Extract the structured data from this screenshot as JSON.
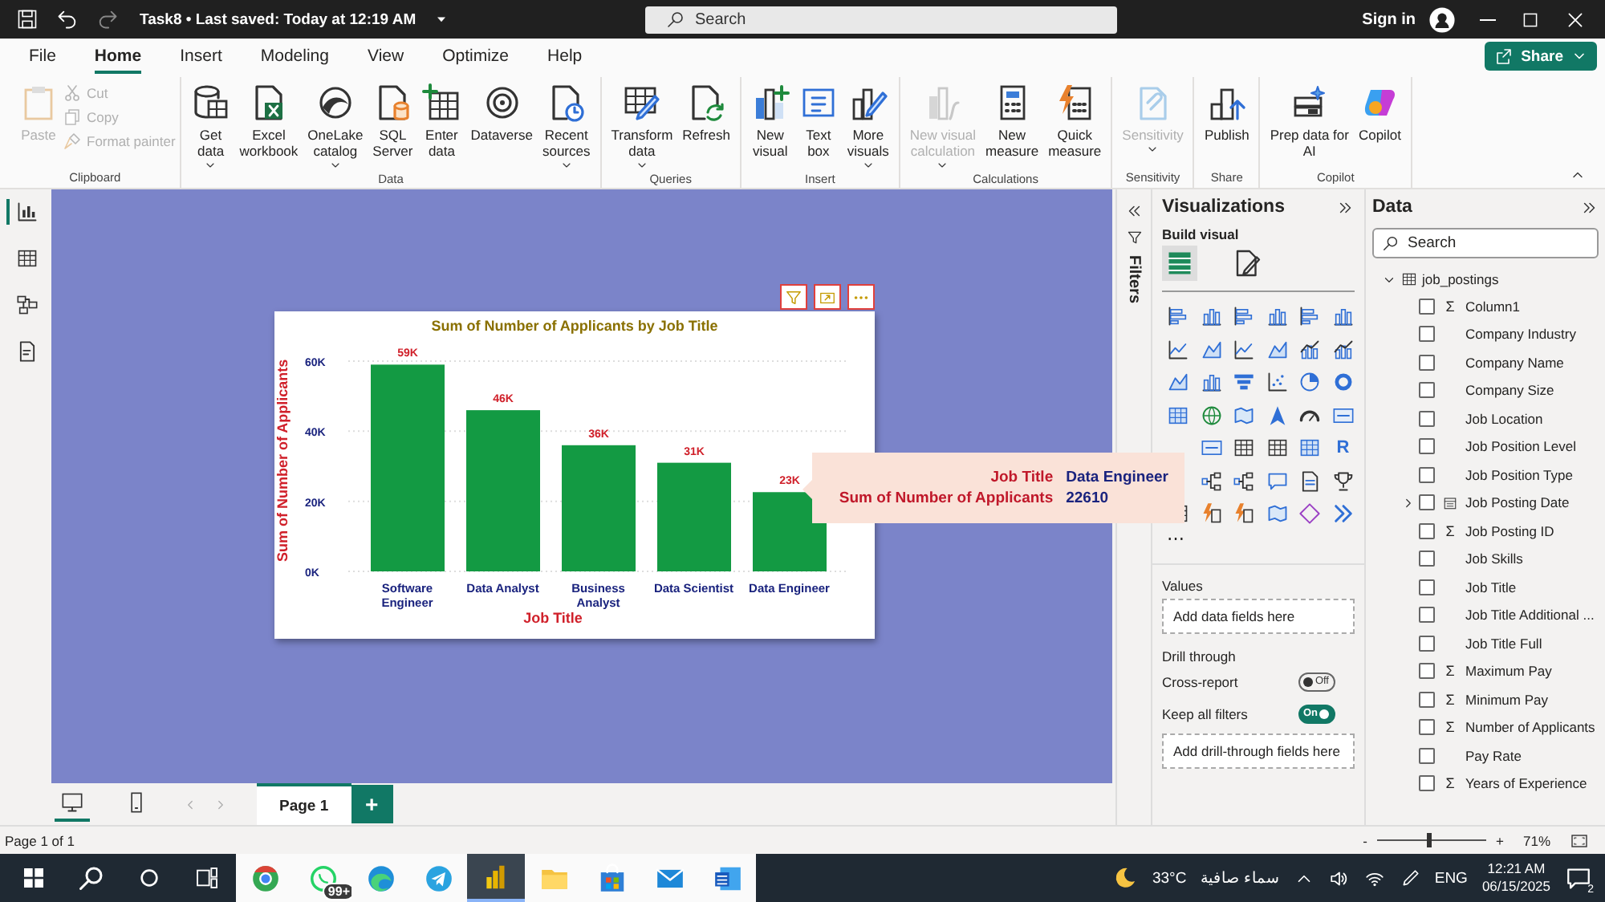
{
  "title_bar": {
    "title": "Task8 • Last saved: Today at 12:19 AM",
    "search_placeholder": "Search",
    "sign_in": "Sign in"
  },
  "ribbon": {
    "tabs": [
      {
        "label": "File",
        "selected": false
      },
      {
        "label": "Home",
        "selected": true
      },
      {
        "label": "Insert",
        "selected": false
      },
      {
        "label": "Modeling",
        "selected": false
      },
      {
        "label": "View",
        "selected": false
      },
      {
        "label": "Optimize",
        "selected": false
      },
      {
        "label": "Help",
        "selected": false
      }
    ],
    "share": "Share",
    "groups": [
      {
        "label": "Clipboard",
        "buttons": [
          {
            "lines": [
              "Paste"
            ],
            "dropdown": false,
            "disabled": true
          }
        ],
        "small_buttons": [
          {
            "label": "Cut",
            "disabled": true
          },
          {
            "label": "Copy",
            "disabled": true
          },
          {
            "label": "Format painter",
            "disabled": true
          }
        ]
      },
      {
        "label": "Data",
        "buttons": [
          {
            "lines": [
              "Get",
              "data"
            ],
            "dropdown": true,
            "disabled": false
          },
          {
            "lines": [
              "Excel",
              "workbook"
            ],
            "dropdown": false,
            "disabled": false
          },
          {
            "lines": [
              "OneLake",
              "catalog"
            ],
            "dropdown": true,
            "disabled": false
          },
          {
            "lines": [
              "SQL",
              "Server"
            ],
            "dropdown": false,
            "disabled": false
          },
          {
            "lines": [
              "Enter",
              "data"
            ],
            "dropdown": false,
            "disabled": false
          },
          {
            "lines": [
              "Dataverse"
            ],
            "dropdown": false,
            "disabled": false
          },
          {
            "lines": [
              "Recent",
              "sources"
            ],
            "dropdown": true,
            "disabled": false
          }
        ]
      },
      {
        "label": "Queries",
        "buttons": [
          {
            "lines": [
              "Transform",
              "data"
            ],
            "dropdown": true,
            "disabled": false
          },
          {
            "lines": [
              "Refresh"
            ],
            "dropdown": false,
            "disabled": false
          }
        ]
      },
      {
        "label": "Insert",
        "buttons": [
          {
            "lines": [
              "New",
              "visual"
            ],
            "dropdown": false,
            "disabled": false
          },
          {
            "lines": [
              "Text",
              "box"
            ],
            "dropdown": false,
            "disabled": false
          },
          {
            "lines": [
              "More",
              "visuals"
            ],
            "dropdown": true,
            "disabled": false
          }
        ]
      },
      {
        "label": "Calculations",
        "buttons": [
          {
            "lines": [
              "New visual",
              "calculation"
            ],
            "dropdown": true,
            "disabled": true
          },
          {
            "lines": [
              "New",
              "measure"
            ],
            "dropdown": false,
            "disabled": false
          },
          {
            "lines": [
              "Quick",
              "measure"
            ],
            "dropdown": false,
            "disabled": false
          }
        ]
      },
      {
        "label": "Sensitivity",
        "buttons": [
          {
            "lines": [
              "Sensitivity"
            ],
            "dropdown": true,
            "disabled": true
          }
        ]
      },
      {
        "label": "Share",
        "buttons": [
          {
            "lines": [
              "Publish"
            ],
            "dropdown": false,
            "disabled": false
          }
        ]
      },
      {
        "label": "Copilot",
        "buttons": [
          {
            "lines": [
              "Prep data for",
              "AI"
            ],
            "dropdown": false,
            "disabled": false
          },
          {
            "lines": [
              "Copilot"
            ],
            "dropdown": false,
            "disabled": false
          }
        ]
      }
    ]
  },
  "left_nav": [
    {
      "selected": true
    },
    {
      "selected": false
    },
    {
      "selected": false
    },
    {
      "selected": false
    }
  ],
  "canvas": {
    "visual": {
      "chart_data": {
        "type": "bar",
        "title": "Sum of Number of Applicants by Job Title",
        "xlabel": "Job Title",
        "ylabel": "Sum of Number of Applicants",
        "categories": [
          "Software Engineer",
          "Data Analyst",
          "Business Analyst",
          "Data Scientist",
          "Data Engineer"
        ],
        "values": [
          59000,
          46000,
          36000,
          31000,
          22610
        ],
        "yticks": [
          {
            "value": 0,
            "label": "0K"
          },
          {
            "value": 20000,
            "label": "20K"
          },
          {
            "value": 40000,
            "label": "40K"
          },
          {
            "value": 60000,
            "label": "60K"
          }
        ],
        "ylim": [
          0,
          60000
        ],
        "value_labels": [
          "59K",
          "46K",
          "36K",
          "31K",
          "23K"
        ]
      }
    },
    "tooltip": {
      "rows": [
        {
          "label": "Job Title",
          "value": "Data Engineer"
        },
        {
          "label": "Sum of Number of Applicants",
          "value": "22610"
        }
      ]
    }
  },
  "filters": {
    "label": "Filters"
  },
  "visualizations": {
    "title": "Visualizations",
    "subtitle": "Build visual",
    "tabs": [
      {
        "selected": true
      },
      {
        "selected": false
      }
    ],
    "r_visual": "R",
    "more": "⋯",
    "values_label": "Values",
    "values_placeholder": "Add data fields here",
    "drill_title": "Drill through",
    "toggles": [
      {
        "label": "Cross-report",
        "on": false,
        "text": "Off"
      },
      {
        "label": "Keep all filters",
        "on": true,
        "text": "On"
      }
    ],
    "drill_placeholder": "Add drill-through fields here"
  },
  "data": {
    "title": "Data",
    "search_placeholder": "Search",
    "tables": [
      {
        "name": "job_postings",
        "expanded": true,
        "fields": [
          {
            "name": "Column1",
            "symbol": "Σ",
            "checked": false
          },
          {
            "name": "Company Industry",
            "checked": false
          },
          {
            "name": "Company Name",
            "checked": false
          },
          {
            "name": "Company Size",
            "checked": false
          },
          {
            "name": "Job Location",
            "checked": false
          },
          {
            "name": "Job Position Level",
            "checked": false
          },
          {
            "name": "Job Position Type",
            "checked": false
          },
          {
            "name": "Job Posting Date",
            "kind": "date",
            "expanded": false,
            "checked": false
          },
          {
            "name": "Job Posting ID",
            "symbol": "Σ",
            "checked": false
          },
          {
            "name": "Job Skills",
            "checked": false
          },
          {
            "name": "Job Title",
            "checked": false
          },
          {
            "name": "Job Title Additional ...",
            "checked": false
          },
          {
            "name": "Job Title Full",
            "checked": false
          },
          {
            "name": "Maximum Pay",
            "symbol": "Σ",
            "checked": false
          },
          {
            "name": "Minimum Pay",
            "symbol": "Σ",
            "checked": false
          },
          {
            "name": "Number of Applicants",
            "symbol": "Σ",
            "checked": false
          },
          {
            "name": "Pay Rate",
            "checked": false
          },
          {
            "name": "Years of Experience",
            "symbol": "Σ",
            "checked": false
          }
        ]
      }
    ]
  },
  "page_bar": {
    "views": [
      {
        "selected": true
      },
      {
        "selected": false
      }
    ],
    "pages": [
      {
        "label": "Page 1",
        "selected": true
      }
    ],
    "add": "+"
  },
  "status_bar": {
    "page": "Page 1 of 1",
    "zoom_out": "-",
    "zoom_in": "+",
    "zoom": {
      "level": 0.45
    },
    "zoom_text": "71%"
  },
  "taskbar": {
    "apps": [
      {
        "selected": false
      },
      {
        "selected": false,
        "badge": "99+"
      },
      {
        "selected": false
      },
      {
        "selected": false
      },
      {
        "selected": true
      },
      {
        "selected": false
      },
      {
        "selected": false
      },
      {
        "selected": false
      },
      {
        "selected": false
      }
    ],
    "temperature": "33°C",
    "weather": "سماء صافية",
    "language": "ENG",
    "time": "12:21 AM",
    "date": "06/15/2025",
    "notifications": "2"
  }
}
